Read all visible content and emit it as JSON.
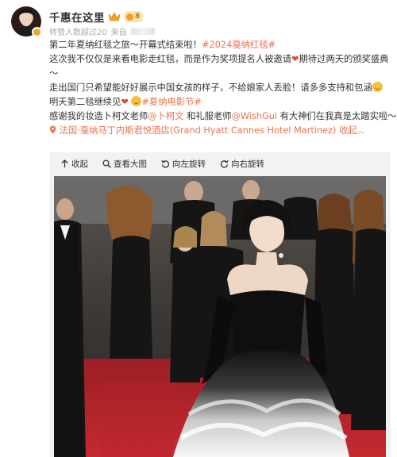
{
  "author": {
    "name": "千惠在这里",
    "vip_label": "8",
    "meta_prefix": "来自",
    "meta_note": "转赞人数超过20"
  },
  "post": {
    "line1_a": "第二年夏纳红毯之旅～开幕式结束啦！",
    "line1_tag": "#2024戛纳红毯#",
    "line2_a": "这次我不仅仅是来看电影走红毯，而是作为奖项提名人被邀请",
    "line2_b": "期待过两天的颁奖盛典",
    "line3": "～",
    "line4": "走出国门只希望能好好展示中国女孩的样子，不给娘家人丢脸！请多多支持和包涵",
    "line5_a": "明天第二毯继续见",
    "line5_tag": "#夏纳电影节#",
    "line6_a": "感谢我的妆造卜柯文老师",
    "line6_mention1": "@卜柯文",
    "line6_b": " 和礼服老师",
    "line6_mention2": "@WishGui",
    "line6_c": " 有大神们在我真是太踏实啦～",
    "location": "法国·戛纳马丁内斯君悦酒店(Grand Hyatt Cannes Hotel Martinez)",
    "collapse_label": "收起"
  },
  "media_toolbar": {
    "collapse": "收起",
    "view_large": "查看大图",
    "rotate_left": "向左旋转",
    "rotate_right": "向右旋转"
  },
  "icons": {
    "avatar_badge": "orange-verified-badge",
    "crown": "crown-icon",
    "location": "location-pin-icon"
  },
  "colors": {
    "link": "#eb7350",
    "heart": "#e2492f",
    "vip": "#f0a020",
    "carpet": "#b4242a"
  }
}
